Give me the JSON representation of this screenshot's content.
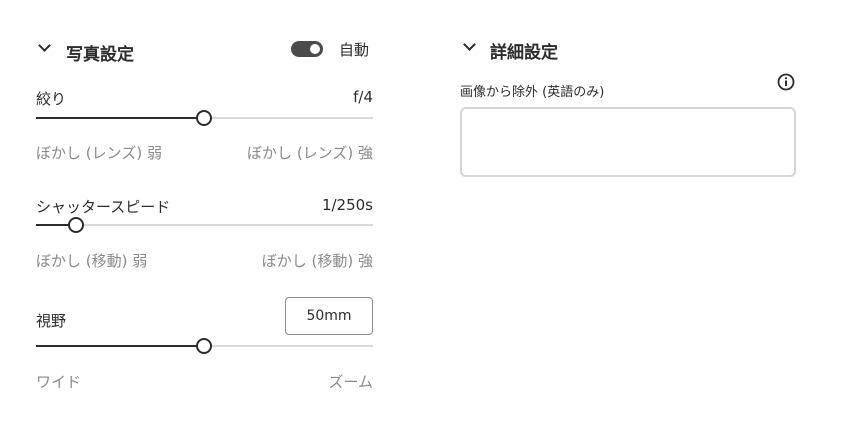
{
  "photo": {
    "title": "写真設定",
    "auto_label": "自動",
    "auto_on": true,
    "aperture": {
      "label": "絞り",
      "value": "f/4",
      "min_label": "ぼかし (レンズ) 弱",
      "max_label": "ぼかし (レンズ) 強",
      "level": 0.5
    },
    "shutter": {
      "label": "シャッタースピード",
      "value": "1/250s",
      "min_label": "ぼかし (移動) 弱",
      "max_label": "ぼかし (移動) 強",
      "level": 0.12
    },
    "fov": {
      "label": "視野",
      "value": "50mm",
      "min_label": "ワイド",
      "max_label": "ズーム",
      "level": 0.5
    }
  },
  "details": {
    "title": "詳細設定",
    "exclude_label": "画像から除外 (英語のみ)",
    "exclude_value": ""
  },
  "icons": {
    "section_chevron": "chevron-down-icon",
    "info": "info-icon"
  },
  "colors": {
    "text": "#2c2c2c",
    "muted": "#8a8a8a",
    "track": "#d9d9d9",
    "toggle_on": "#4b4b4b"
  }
}
